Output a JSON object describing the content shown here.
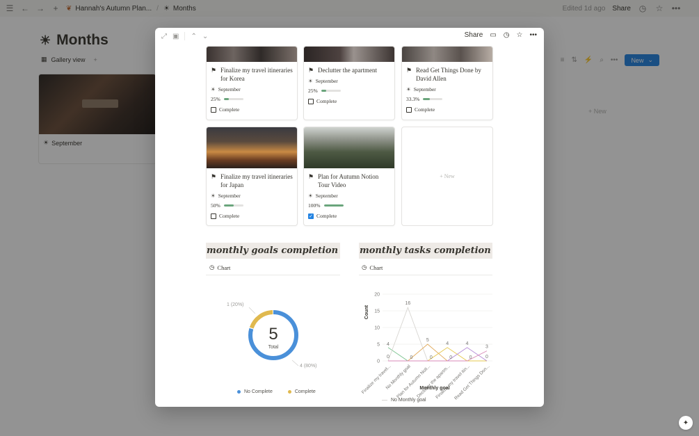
{
  "topbar": {
    "breadcrumb_workspace": "Hannah's Autumn Plan...",
    "breadcrumb_page": "Months",
    "edited": "Edited 1d ago",
    "share": "Share"
  },
  "background": {
    "title": "Months",
    "view_label": "Gallery view",
    "new_label": "New",
    "card_label": "September",
    "ghost_new": "+ New"
  },
  "modal": {
    "share": "Share",
    "cards": [
      {
        "title": "Finalize my travel itineraries for Korea",
        "month": "September",
        "progress_label": "25%",
        "progress": 0.25,
        "check_label": "Complete",
        "checked": false
      },
      {
        "title": "Declutter the apartment",
        "month": "September",
        "progress_label": "25%",
        "progress": 0.25,
        "check_label": "Complete",
        "checked": false
      },
      {
        "title": "Read Get Things Done by David Allen",
        "month": "September",
        "progress_label": "33.3%",
        "progress": 0.333,
        "check_label": "Complete",
        "checked": false
      },
      {
        "title": "Finalize my travel itineraries for Japan",
        "month": "September",
        "progress_label": "50%",
        "progress": 0.5,
        "check_label": "Complete",
        "checked": false
      },
      {
        "title": "Plan for Autumn Notion Tour Video",
        "month": "September",
        "progress_label": "100%",
        "progress": 1.0,
        "check_label": "Complete",
        "checked": true
      }
    ],
    "new_card": "+ New",
    "goals": {
      "heading": "monthly goals completion",
      "tab": "Chart"
    },
    "tasks": {
      "heading": "monthly tasks completion",
      "tab": "Chart"
    }
  },
  "chart_data": [
    {
      "type": "pie",
      "total_value": "5",
      "total_label": "Total",
      "slices": [
        {
          "name": "No Complete",
          "value": 4,
          "label": "4 (80%)",
          "color": "#4a90d9"
        },
        {
          "name": "Complete",
          "value": 1,
          "label": "1 (20%)",
          "color": "#e0b94f"
        }
      ],
      "legend": [
        "No Complete",
        "Complete"
      ],
      "legend_position": "bottom"
    },
    {
      "type": "line",
      "xlabel": "Monthly goal",
      "ylabel": "Count",
      "ylim": [
        0,
        20
      ],
      "yticks": [
        "0",
        "5",
        "10",
        "15",
        "20"
      ],
      "categories": [
        "Finalize my travel...",
        "No Monthly goal",
        "Plan for Autumn Noti...",
        "Declutter the apartm...",
        "Finalize my travel itin...",
        "Read Get Things Don..."
      ],
      "series": [
        {
          "name": "",
          "color": "#7cc38f",
          "values": [
            4,
            0,
            0,
            0,
            0,
            0
          ]
        },
        {
          "name": "No Monthly goal",
          "color": "#d8d6d2",
          "values": [
            0,
            16,
            0,
            0,
            0,
            0
          ]
        },
        {
          "name": "",
          "color": "#e0a95a",
          "values": [
            0,
            0,
            5,
            0,
            0,
            0
          ]
        },
        {
          "name": "",
          "color": "#e6c84f",
          "values": [
            0,
            0,
            0,
            4,
            0,
            0
          ]
        },
        {
          "name": "",
          "color": "#b48ad6",
          "values": [
            0,
            0,
            0,
            0,
            4,
            0
          ]
        },
        {
          "name": "",
          "color": "#d98ab8",
          "values": [
            0,
            0,
            0,
            0,
            0,
            3
          ]
        }
      ],
      "point_labels": [
        {
          "i": 0,
          "label": "4"
        },
        {
          "i": 0,
          "label": "0",
          "alt": true
        },
        {
          "i": 1,
          "label": "16"
        },
        {
          "i": 1,
          "label": "0",
          "alt": true
        },
        {
          "i": 2,
          "label": "5"
        },
        {
          "i": 2,
          "label": "0",
          "alt": true
        },
        {
          "i": 3,
          "label": "4"
        },
        {
          "i": 3,
          "label": "0",
          "alt": true
        },
        {
          "i": 4,
          "label": "4"
        },
        {
          "i": 4,
          "label": "0",
          "alt": true
        },
        {
          "i": 5,
          "label": "3"
        },
        {
          "i": 5,
          "label": "0",
          "alt": true
        }
      ],
      "legend": [
        "No Monthly goal"
      ],
      "legend_position": "bottom"
    }
  ]
}
